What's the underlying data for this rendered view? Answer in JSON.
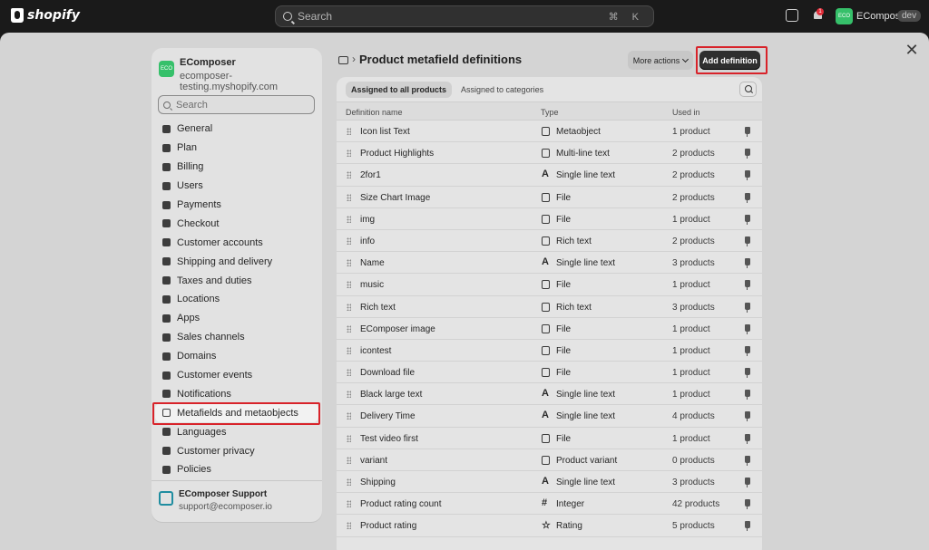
{
  "topbar": {
    "logo_text": "shopify",
    "search_placeholder": "Search",
    "search_shortcut": "⌘ K",
    "notification_count": "1",
    "store_chip": "ECO",
    "store_name": "EComposer",
    "env_badge": "dev"
  },
  "sidebar": {
    "store_avatar": "ECO",
    "store_title": "EComposer",
    "store_url": "ecomposer-testing.myshopify.com",
    "search_placeholder": "Search",
    "items": [
      {
        "label": "General",
        "icon": "store-icon"
      },
      {
        "label": "Plan",
        "icon": "plan-icon"
      },
      {
        "label": "Billing",
        "icon": "billing-icon"
      },
      {
        "label": "Users",
        "icon": "users-icon"
      },
      {
        "label": "Payments",
        "icon": "payments-icon"
      },
      {
        "label": "Checkout",
        "icon": "cart-icon"
      },
      {
        "label": "Customer accounts",
        "icon": "person-icon"
      },
      {
        "label": "Shipping and delivery",
        "icon": "truck-icon"
      },
      {
        "label": "Taxes and duties",
        "icon": "taxes-icon"
      },
      {
        "label": "Locations",
        "icon": "location-icon"
      },
      {
        "label": "Apps",
        "icon": "apps-icon"
      },
      {
        "label": "Sales channels",
        "icon": "channels-icon"
      },
      {
        "label": "Domains",
        "icon": "globe-icon"
      },
      {
        "label": "Customer events",
        "icon": "cursor-icon"
      },
      {
        "label": "Notifications",
        "icon": "bell-icon"
      },
      {
        "label": "Metafields and metaobjects",
        "icon": "metafields-icon"
      },
      {
        "label": "Languages",
        "icon": "language-icon"
      },
      {
        "label": "Customer privacy",
        "icon": "lock-icon"
      },
      {
        "label": "Policies",
        "icon": "policies-icon"
      }
    ],
    "active_index": 15,
    "support_name": "EComposer Support",
    "support_email": "support@ecomposer.io"
  },
  "header": {
    "title": "Product metafield definitions",
    "more_actions": "More actions",
    "add_definition": "Add definition"
  },
  "tabs": [
    "Assigned to all products",
    "Assigned to categories"
  ],
  "table": {
    "columns": [
      "Definition name",
      "Type",
      "Used in"
    ],
    "rows": [
      {
        "name": "Icon list Text",
        "type": "Metaobject",
        "icon": "metaobject-icon",
        "used": "1 product"
      },
      {
        "name": "Product Highlights",
        "type": "Multi-line text",
        "icon": "multiline-icon",
        "used": "2 products"
      },
      {
        "name": "2for1",
        "type": "Single line text",
        "icon": "text-icon",
        "used": "2 products"
      },
      {
        "name": "Size Chart Image",
        "type": "File",
        "icon": "file-icon",
        "used": "2 products"
      },
      {
        "name": "img",
        "type": "File",
        "icon": "file-icon",
        "used": "1 product"
      },
      {
        "name": "info",
        "type": "Rich text",
        "icon": "richtext-icon",
        "used": "2 products"
      },
      {
        "name": "Name",
        "type": "Single line text",
        "icon": "text-icon",
        "used": "3 products"
      },
      {
        "name": "music",
        "type": "File",
        "icon": "file-icon",
        "used": "1 product"
      },
      {
        "name": "Rich text",
        "type": "Rich text",
        "icon": "richtext-icon",
        "used": "3 products"
      },
      {
        "name": "EComposer image",
        "type": "File",
        "icon": "file-icon",
        "used": "1 product"
      },
      {
        "name": "icontest",
        "type": "File",
        "icon": "file-icon",
        "used": "1 product"
      },
      {
        "name": "Download file",
        "type": "File",
        "icon": "file-icon",
        "used": "1 product"
      },
      {
        "name": "Black large text",
        "type": "Single line text",
        "icon": "text-icon",
        "used": "1 product"
      },
      {
        "name": "Delivery Time",
        "type": "Single line text",
        "icon": "text-icon",
        "used": "4 products"
      },
      {
        "name": "Test video first",
        "type": "File",
        "icon": "file-icon",
        "used": "1 product"
      },
      {
        "name": "variant",
        "type": "Product variant",
        "icon": "variant-icon",
        "used": "0 products"
      },
      {
        "name": "Shipping",
        "type": "Single line text",
        "icon": "text-icon",
        "used": "3 products"
      },
      {
        "name": "Product rating count",
        "type": "Integer",
        "icon": "hash-icon",
        "used": "42 products"
      },
      {
        "name": "Product rating",
        "type": "Rating",
        "icon": "star-icon",
        "used": "5 products"
      }
    ]
  }
}
